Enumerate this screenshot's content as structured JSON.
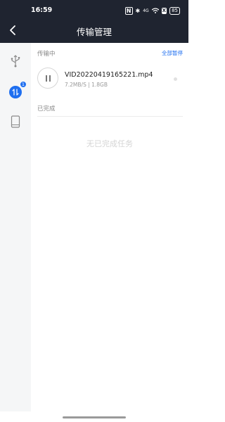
{
  "status_bar": {
    "time": "16:59",
    "nfc": "N",
    "bluetooth": "✱",
    "signal": "4G",
    "x_label": "X",
    "battery": "85"
  },
  "header": {
    "title": "传输管理"
  },
  "sidebar": {
    "items": [
      {
        "icon": "usb-icon"
      },
      {
        "icon": "transfer-icon",
        "badge": "1"
      },
      {
        "icon": "phone-icon"
      }
    ]
  },
  "transferring": {
    "label": "传输中",
    "pause_all": "全部暂停",
    "task": {
      "file_name": "VID20220419165221.mp4",
      "meta": "7.2MB/S | 1.8GB"
    }
  },
  "completed": {
    "label": "已完成",
    "empty_text": "无已完成任务"
  },
  "colors": {
    "header_bg": "#1f2430",
    "accent": "#1f6ff0",
    "sidebar_bg": "#f5f6f7"
  }
}
